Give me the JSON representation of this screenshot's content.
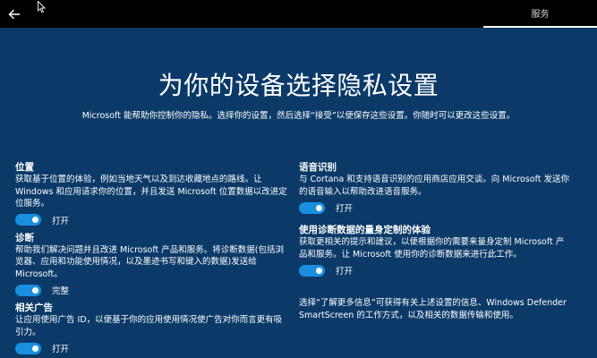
{
  "topbar": {
    "back_icon": "back-arrow-icon",
    "tab_label": "服务"
  },
  "title": "为你的设备选择隐私设置",
  "subtitle": "Microsoft 能帮助你控制你的隐私。选择你的设置，然后选择“接受”以便保存这些设置。你随时可以更改这些设置。",
  "left_items": [
    {
      "title": "位置",
      "desc": "获取基于位置的体验，例如当地天气以及到达收藏地点的路线。让 Windows 和应用请求你的位置，并且发送 Microsoft 位置数据以改进定位服务。",
      "toggle_on": true,
      "toggle_label": "打开"
    },
    {
      "title": "诊断",
      "desc": "帮助我们解决问题并且改进 Microsoft 产品和服务。将诊断数据(包括浏览器、应用和功能使用情况，以及墨迹书写和键入的数据)发送给 Microsoft。",
      "toggle_on": true,
      "toggle_label": "完整"
    },
    {
      "title": "相关广告",
      "desc": "让应用使用广告 ID，以便基于你的应用使用情况使广告对你而言更有吸引力。",
      "toggle_on": true,
      "toggle_label": "打开"
    }
  ],
  "right_items": [
    {
      "title": "语音识别",
      "desc": "与 Cortana 和支持语音识别的应用商店应用交谈。向 Microsoft 发送你的语音输入以帮助改进语音服务。",
      "toggle_on": true,
      "toggle_label": "打开"
    },
    {
      "title": "使用诊断数据的量身定制的体验",
      "desc": "获取更相关的提示和建议，以便根据你的需要来量身定制 Microsoft 产品和服务。让 Microsoft 使用你的诊断数据来进行此工作。",
      "toggle_on": true,
      "toggle_label": "打开"
    }
  ],
  "note": "选择“了解更多信息”可获得有关上述设置的信息、Windows Defender SmartScreen 的工作方式，以及相关的数据传输和使用。",
  "colors": {
    "background": "#0b3a68",
    "topbar": "#000000",
    "toggle_on": "#1a8fe0"
  }
}
